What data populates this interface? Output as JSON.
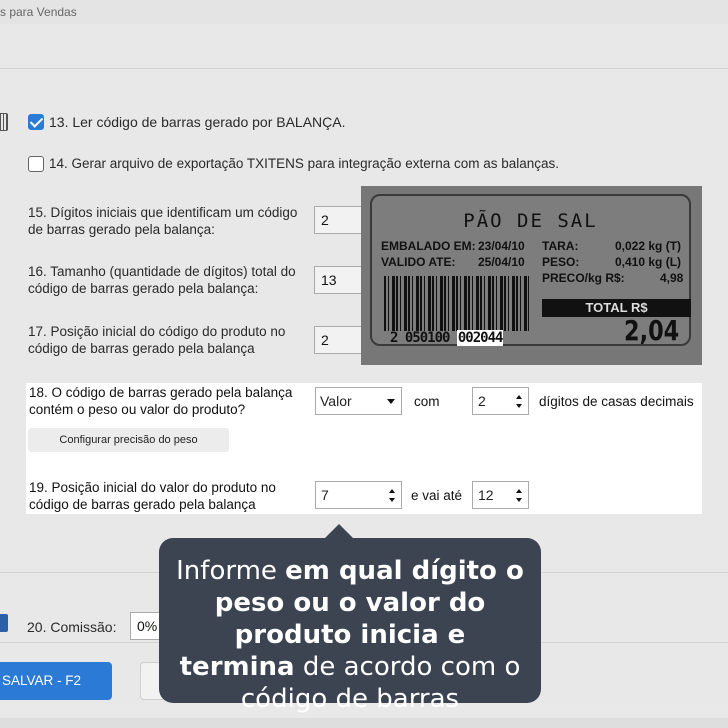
{
  "window": {
    "title": "s para Vendas"
  },
  "options": {
    "opt13": {
      "label": "13. Ler código de barras gerado por BALANÇA.",
      "checked": true
    },
    "opt14": {
      "label": "14. Gerar arquivo de exportação TXITENS para integração externa com as balanças.",
      "checked": false
    },
    "opt15": {
      "label_line1": "15. Dígitos iniciais que identificam um código",
      "label_line2": "de barras gerado pela balança:",
      "value": "2"
    },
    "opt16": {
      "label_line1": "16. Tamanho (quantidade de dígitos) total do",
      "label_line2": "código de barras gerado pela balança:",
      "value": "13"
    },
    "opt17": {
      "label_line1": "17. Posição inicial do código do produto no",
      "label_line2": "código de barras gerado pela balança",
      "value": "2"
    },
    "opt18": {
      "label_line1": "18. O código de barras gerado pela balança",
      "label_line2": "contém o peso ou valor do produto?",
      "select_value": "Valor",
      "com_label": "com",
      "decimals_value": "2",
      "decimals_label": "dígitos de casas decimais",
      "configure_button": "Configurar precisão do peso"
    },
    "opt19": {
      "label_line1": "19. Posição inicial do valor do produto no",
      "label_line2": "código de barras gerado pela balança",
      "start_value": "7",
      "until_label": "e vai até",
      "end_value": "12"
    },
    "opt20": {
      "label": "20. Comissão:",
      "value": "0%"
    }
  },
  "scale_label": {
    "title": "PÃO DE SAL",
    "packed_label": "EMBALADO EM:",
    "packed_date": "23/04/10",
    "valid_label": "VALIDO ATE:",
    "valid_date": "25/04/10",
    "tare_label": "TARA:",
    "tare_value": "0,022 kg (T)",
    "weight_label": "PESO:",
    "weight_value": "0,410 kg (L)",
    "price_label": "PRECO/kg R$:",
    "price_value": "4,98",
    "total_label": "TOTAL R$",
    "total_value": "2,04",
    "barcode_prefix": "2 050100 ",
    "barcode_highlight": "002044"
  },
  "tooltip": {
    "part1": "Informe ",
    "bold1": "em qual dígito o peso ou o valor do produto inicia e termina",
    "part2": " de acordo com o código de barras"
  },
  "footer": {
    "save_button": "SALVAR - F2"
  },
  "colors": {
    "accent": "#2b7bd6",
    "tooltip_bg": "#3c4452"
  }
}
